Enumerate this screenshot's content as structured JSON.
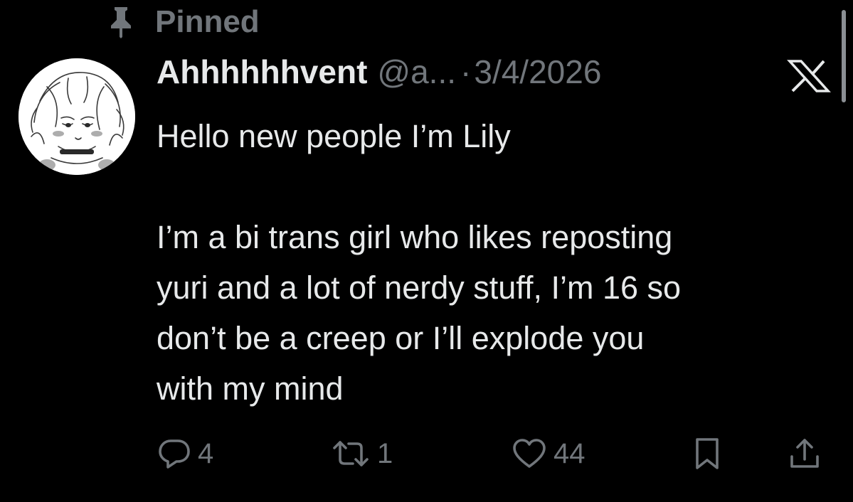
{
  "pinned": {
    "label": "Pinned",
    "icon": "pin-icon"
  },
  "author": {
    "display_name": "Ahhhhhhvent",
    "handle": "@a...",
    "separator": "·",
    "date": "3/4/2026",
    "avatar_icon": "avatar-sketch"
  },
  "platform_icon": "x-logo-icon",
  "tweet": {
    "line1": "Hello new people I’m Lily",
    "line2": "I’m a bi trans girl who likes reposting",
    "line3": "yuri and a lot of nerdy stuff, I’m 16 so",
    "line4": "don’t be a creep or I’ll explode you",
    "line5": "with my mind"
  },
  "actions": {
    "reply": {
      "icon": "reply-icon",
      "count": "4"
    },
    "repost": {
      "icon": "repost-icon",
      "count": "1"
    },
    "like": {
      "icon": "heart-icon",
      "count": "44"
    },
    "bookmark": {
      "icon": "bookmark-icon"
    },
    "share": {
      "icon": "share-icon"
    }
  },
  "colors": {
    "background": "#000000",
    "primary_text": "#e7e9ea",
    "secondary_text": "#71767b"
  }
}
